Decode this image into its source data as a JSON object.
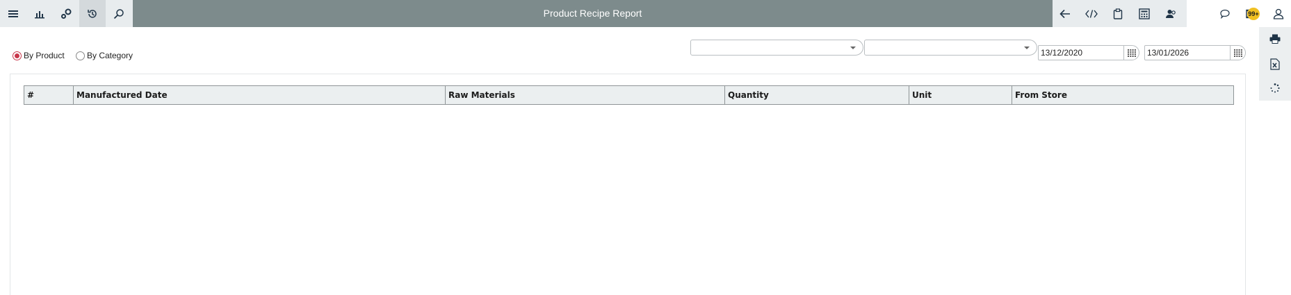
{
  "app": {
    "title": "Product Recipe Report"
  },
  "toolbar_left": [
    {
      "icon": "menu-icon"
    },
    {
      "icon": "bar-chart-icon"
    },
    {
      "icon": "settings-gears-icon"
    },
    {
      "icon": "history-icon"
    },
    {
      "icon": "search-icon"
    }
  ],
  "toolbar_right": [
    {
      "icon": "back-arrow-icon"
    },
    {
      "icon": "code-icon"
    },
    {
      "icon": "clipboard-icon"
    },
    {
      "icon": "calculator-icon"
    },
    {
      "icon": "users-icon"
    },
    {
      "icon": "chat-icon"
    },
    {
      "icon": "mail-icon"
    },
    {
      "icon": "user-icon"
    }
  ],
  "notifications": {
    "badge": "99+"
  },
  "side_actions": [
    {
      "icon": "print-icon"
    },
    {
      "icon": "excel-export-icon"
    },
    {
      "icon": "refresh-spinner-icon"
    }
  ],
  "filters": {
    "mode": {
      "selected": "By Product",
      "options": [
        "By Product",
        "By Category"
      ]
    },
    "dropdown1": {
      "value": ""
    },
    "dropdown2": {
      "value": ""
    },
    "date_from": "13/12/2020",
    "date_to": "13/01/2026"
  },
  "table": {
    "columns": [
      "#",
      "Manufactured Date",
      "Raw Materials",
      "Quantity",
      "Unit",
      "From Store"
    ],
    "rows": []
  },
  "colors": {
    "topbar": "#7d8b8c",
    "toolbar_bg": "#e8ecee",
    "radio_accent": "#c8364a",
    "badge": "#f0c022",
    "icon": "#1f3447"
  }
}
